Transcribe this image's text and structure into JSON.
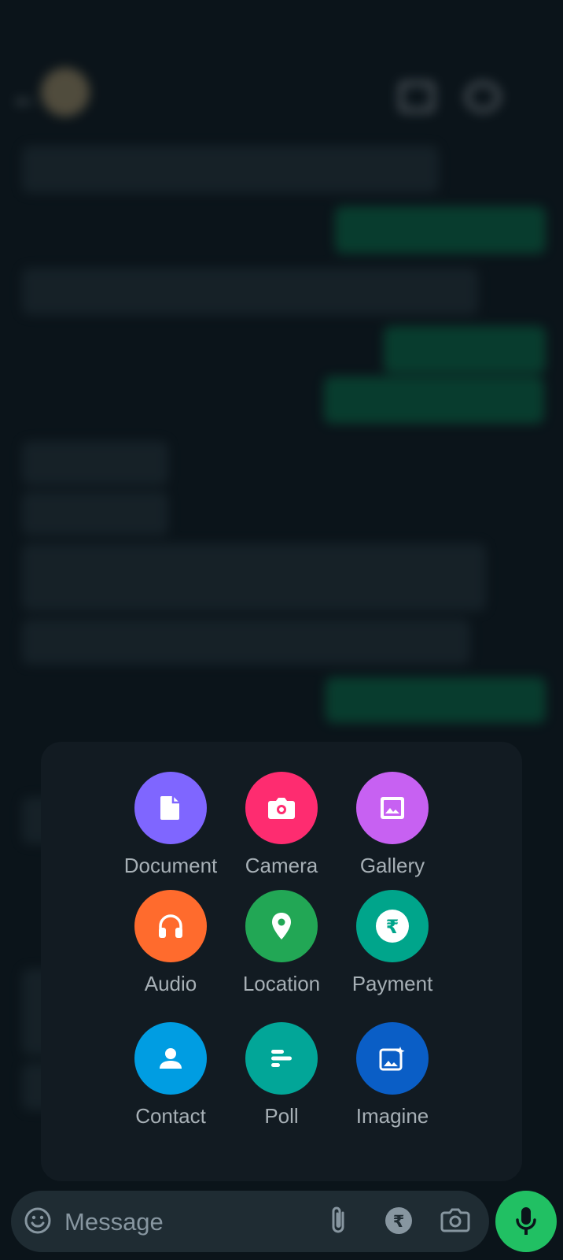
{
  "attach_menu": {
    "items": [
      {
        "label": "Document",
        "icon": "document-icon",
        "color": "#7f66ff"
      },
      {
        "label": "Camera",
        "icon": "camera-icon",
        "color": "#fe2c70"
      },
      {
        "label": "Gallery",
        "icon": "gallery-icon",
        "color": "#c761f2"
      },
      {
        "label": "Audio",
        "icon": "headphones-icon",
        "color": "#ff6b2d"
      },
      {
        "label": "Location",
        "icon": "location-pin-icon",
        "color": "#22a755"
      },
      {
        "label": "Payment",
        "icon": "rupee-icon",
        "color": "#00a58b"
      },
      {
        "label": "Contact",
        "icon": "contact-person-icon",
        "color": "#009de2"
      },
      {
        "label": "Poll",
        "icon": "poll-icon",
        "color": "#02a698"
      },
      {
        "label": "Imagine",
        "icon": "imagine-icon",
        "color": "#0a5ec6"
      }
    ]
  },
  "composer": {
    "placeholder": "Message"
  },
  "colors": {
    "sheet_bg": "#121b22",
    "composer_bg": "#1f2c33",
    "mic_button": "#21c063",
    "app_bg": "#0b141a"
  }
}
